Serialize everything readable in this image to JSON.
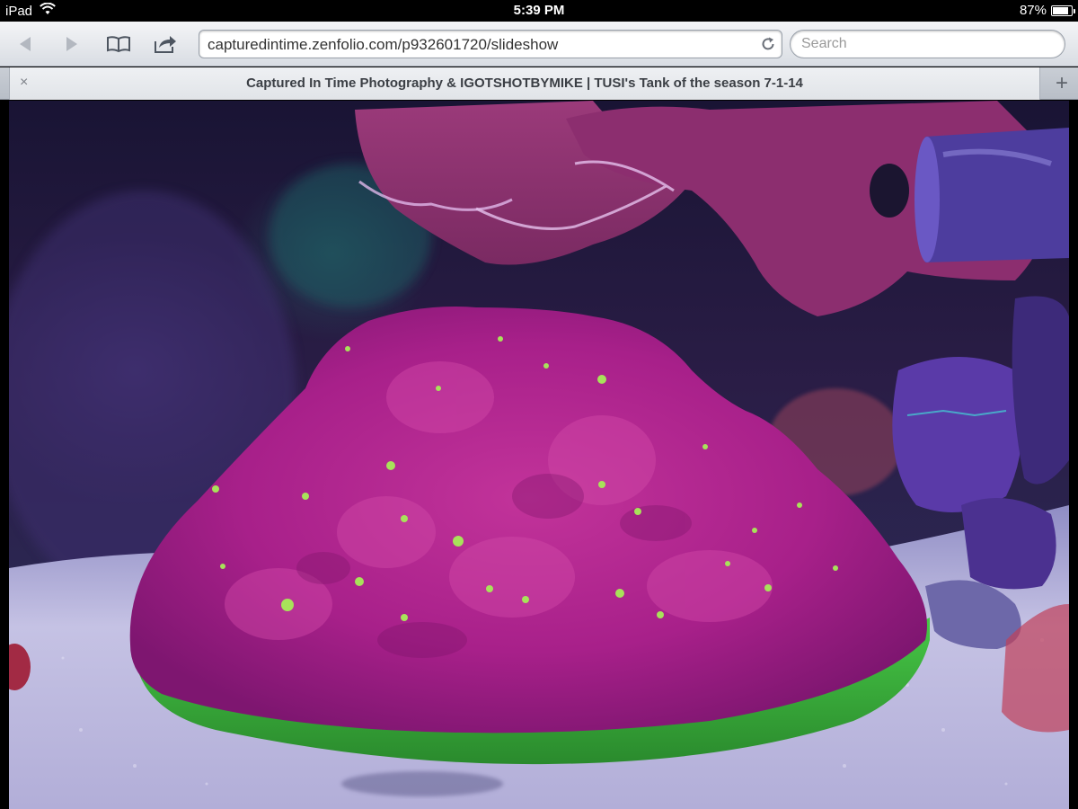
{
  "status_bar": {
    "device": "iPad",
    "time": "5:39 PM",
    "battery": "87%",
    "battery_level": 0.87
  },
  "toolbar": {
    "back_icon": "back-arrow-icon",
    "forward_icon": "forward-arrow-icon",
    "bookmarks_icon": "bookmarks-book-icon",
    "share_icon": "share-icon",
    "url": "capturedintime.zenfolio.com/p932601720/slideshow",
    "reload_icon": "reload-icon",
    "search_placeholder": "Search"
  },
  "tabs": {
    "close_glyph": "×",
    "title": "Captured In Time Photography & IGOTSHOTBYMIKE | TUSI's Tank of the season 7-1-14",
    "new_tab_glyph": "+"
  },
  "colors": {
    "coral_magenta": "#b8248f",
    "coral_rim_green": "#3fbf3a",
    "sand": "#c9c6e6",
    "background": "#1e1838"
  }
}
